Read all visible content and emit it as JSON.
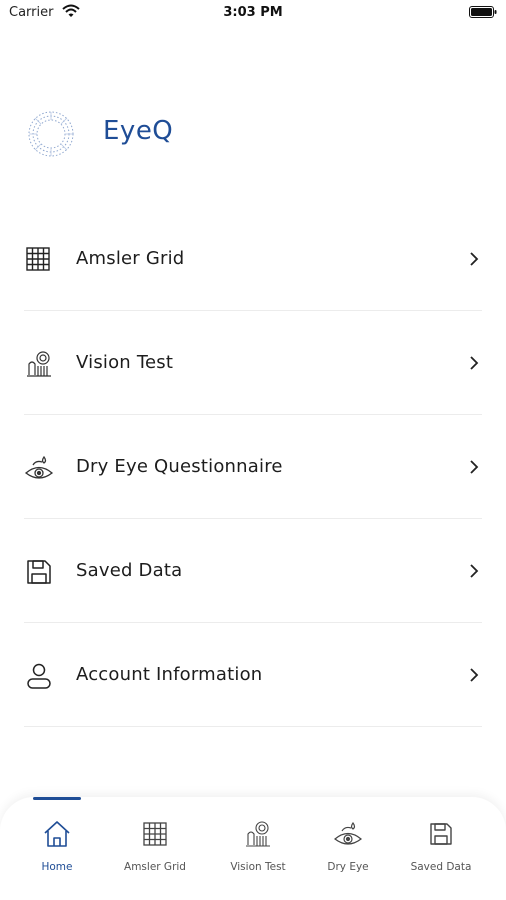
{
  "status_bar": {
    "carrier": "Carrier",
    "time": "3:03 PM"
  },
  "header": {
    "app_title": "EyeQ"
  },
  "menu": {
    "items": [
      {
        "label": "Amsler Grid",
        "icon": "grid-icon"
      },
      {
        "label": "Vision Test",
        "icon": "vision-test-icon"
      },
      {
        "label": "Dry Eye Questionnaire",
        "icon": "dry-eye-icon"
      },
      {
        "label": "Saved Data",
        "icon": "save-icon"
      },
      {
        "label": "Account Information",
        "icon": "user-icon"
      }
    ]
  },
  "tabbar": {
    "active": "Home",
    "tabs": [
      {
        "label": "Home",
        "icon": "home-icon"
      },
      {
        "label": "Amsler Grid",
        "icon": "grid-icon"
      },
      {
        "label": "Vision Test",
        "icon": "vision-test-icon"
      },
      {
        "label": "Dry Eye",
        "icon": "dry-eye-icon"
      },
      {
        "label": "Saved Data",
        "icon": "save-icon"
      }
    ]
  },
  "colors": {
    "accent": "#1f4d96",
    "text": "#1d1d1d",
    "divider": "#ececec"
  }
}
